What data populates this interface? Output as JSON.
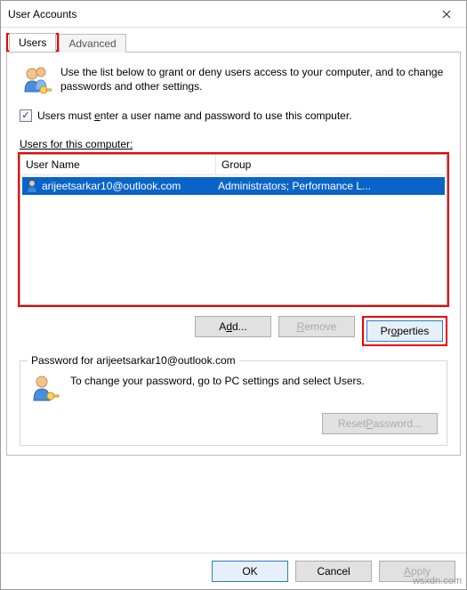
{
  "titlebar": {
    "title": "User Accounts"
  },
  "tabs": {
    "users": "Users",
    "advanced": "Advanced"
  },
  "intro": "Use the list below to grant or deny users access to your computer, and to change passwords and other settings.",
  "checkbox_label_pre": "Users must ",
  "checkbox_label_u": "e",
  "checkbox_label_post": "nter a user name and password to use this computer.",
  "users_label_u": "U",
  "users_label_rest": "sers for this computer:",
  "table": {
    "header_user": "User Name",
    "header_group": "Group",
    "rows": [
      {
        "user": "arijeetsarkar10@outlook.com",
        "group": "Administrators; Performance L..."
      }
    ]
  },
  "buttons": {
    "add_pre": "A",
    "add_u": "d",
    "add_post": "d...",
    "remove_u": "R",
    "remove_rest": "emove",
    "props_pre": "Pr",
    "props_u": "o",
    "props_post": "perties",
    "reset_pre": "Reset ",
    "reset_u": "P",
    "reset_post": "assword...",
    "ok": "OK",
    "cancel": "Cancel",
    "apply_u": "A",
    "apply_rest": "pply"
  },
  "password_box": {
    "legend": "Password for arijeetsarkar10@outlook.com",
    "text": "To change your password, go to PC settings and select Users."
  },
  "watermark": "wsxdn.com"
}
